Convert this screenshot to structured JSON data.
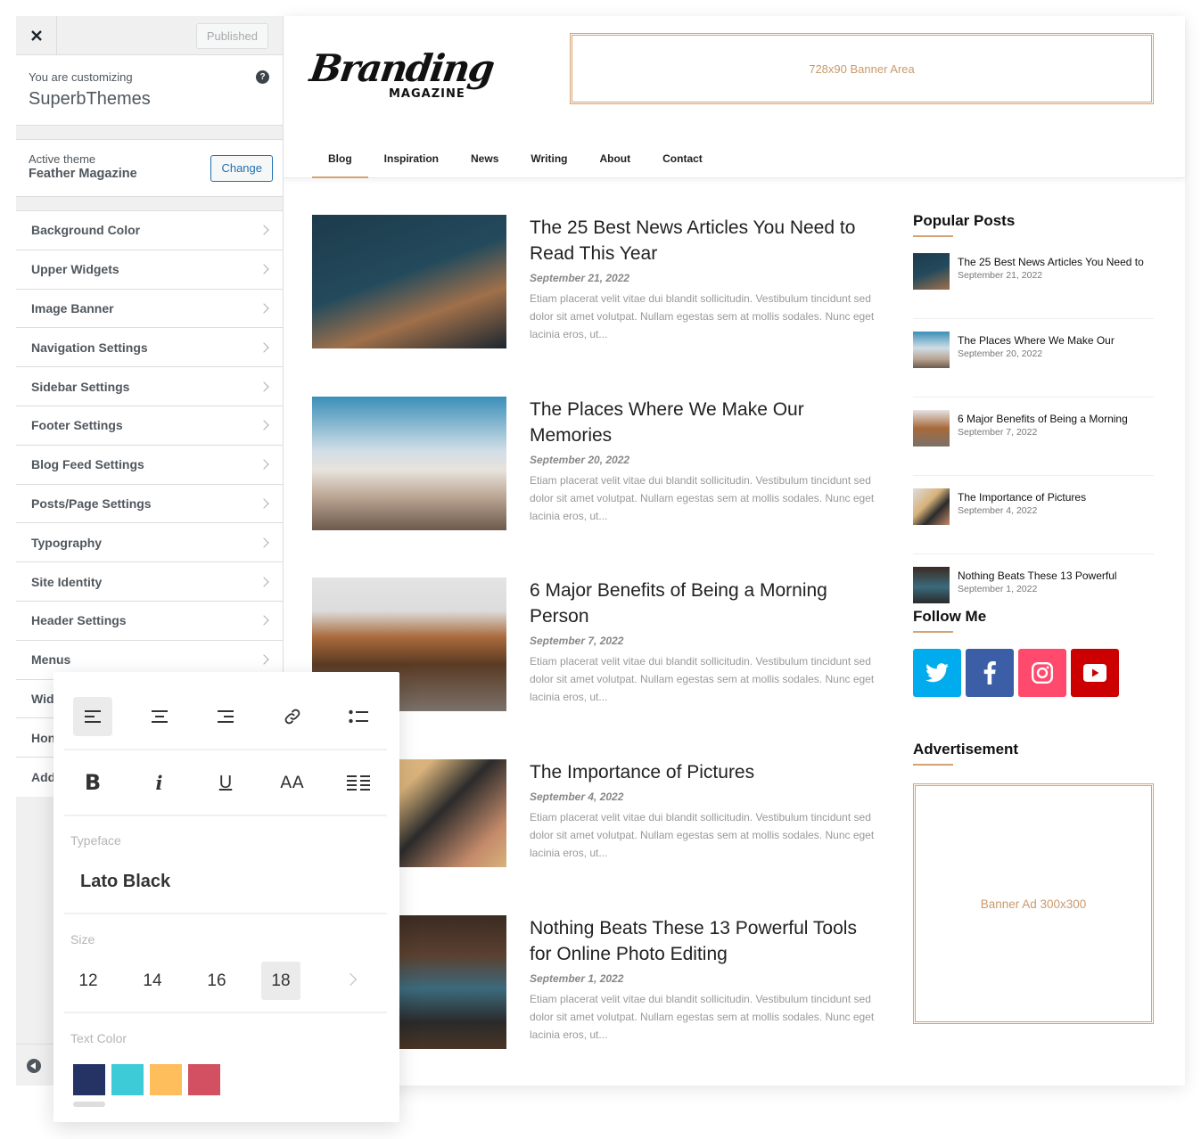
{
  "customizer": {
    "close_icon": "close-icon",
    "published_label": "Published",
    "customizing_label": "You are customizing",
    "site_name": "SuperbThemes",
    "help_icon": "?",
    "active_theme_label": "Active theme",
    "active_theme_name": "Feather Magazine",
    "change_label": "Change",
    "sections": [
      {
        "label": "Background Color"
      },
      {
        "label": "Upper Widgets"
      },
      {
        "label": "Image Banner"
      },
      {
        "label": "Navigation Settings"
      },
      {
        "label": "Sidebar Settings"
      },
      {
        "label": "Footer Settings"
      },
      {
        "label": "Blog Feed Settings"
      },
      {
        "label": "Posts/Page Settings"
      },
      {
        "label": "Typography"
      },
      {
        "label": "Site Identity"
      },
      {
        "label": "Header Settings"
      },
      {
        "label": "Menus"
      },
      {
        "label": "Wid"
      },
      {
        "label": "Hon"
      },
      {
        "label": "Add"
      }
    ]
  },
  "format_panel": {
    "align_buttons": [
      "align-left-icon",
      "align-center-icon",
      "align-right-icon",
      "link-icon",
      "list-icon"
    ],
    "style_buttons": {
      "bold": "B",
      "italic": "i",
      "underline": "U",
      "caps": "AA",
      "justify": "justify-icon"
    },
    "typeface_label": "Typeface",
    "typeface_value": "Lato Black",
    "size_label": "Size",
    "sizes": [
      "12",
      "14",
      "16",
      "18"
    ],
    "selected_size": "18",
    "text_color_label": "Text Color",
    "colors": [
      "#243364",
      "#3ecbd8",
      "#ffbe5c",
      "#d25062"
    ],
    "selected_color": "#243364"
  },
  "site": {
    "logo_script": "Branding",
    "logo_sub": "MAGAZINE",
    "top_banner": "728x90 Banner Area",
    "nav": [
      {
        "label": "Blog",
        "active": true
      },
      {
        "label": "Inspiration"
      },
      {
        "label": "News"
      },
      {
        "label": "Writing"
      },
      {
        "label": "About"
      },
      {
        "label": "Contact"
      }
    ],
    "posts": [
      {
        "title": "The 25 Best News Articles You Need to Read This Year",
        "date": "September 21, 2022",
        "excerpt": "Etiam placerat velit vitae dui blandit sollicitudin. Vestibulum tincidunt sed dolor sit amet volutpat. Nullam egestas sem at mollis sodales. Nunc eget lacinia eros, ut..."
      },
      {
        "title": "The Places Where We Make Our Memories",
        "date": "September 20, 2022",
        "excerpt": "Etiam placerat velit vitae dui blandit sollicitudin. Vestibulum tincidunt sed dolor sit amet volutpat. Nullam egestas sem at mollis sodales. Nunc eget lacinia eros, ut..."
      },
      {
        "title": "6 Major Benefits of Being a Morning Person",
        "date": "September 7, 2022",
        "excerpt": "Etiam placerat velit vitae dui blandit sollicitudin. Vestibulum tincidunt sed dolor sit amet volutpat. Nullam egestas sem at mollis sodales. Nunc eget lacinia eros, ut..."
      },
      {
        "title": "The Importance of Pictures",
        "date": "September 4, 2022",
        "excerpt": "Etiam placerat velit vitae dui blandit sollicitudin. Vestibulum tincidunt sed dolor sit amet volutpat. Nullam egestas sem at mollis sodales. Nunc eget lacinia eros, ut..."
      },
      {
        "title": "Nothing Beats These 13 Powerful Tools for Online Photo Editing",
        "date": "September 1, 2022",
        "excerpt": "Etiam placerat velit vitae dui blandit sollicitudin. Vestibulum tincidunt sed dolor sit amet volutpat. Nullam egestas sem at mollis sodales. Nunc eget lacinia eros, ut..."
      }
    ],
    "popular_posts_title": "Popular Posts",
    "popular_posts": [
      {
        "title": "The 25 Best News Articles You Need to",
        "date": "September 21, 2022"
      },
      {
        "title": "The Places Where We Make Our",
        "date": "September 20, 2022"
      },
      {
        "title": "6 Major Benefits of Being a Morning",
        "date": "September 7, 2022"
      },
      {
        "title": "The Importance of Pictures",
        "date": "September 4, 2022"
      },
      {
        "title": "Nothing Beats These 13 Powerful",
        "date": "September 1, 2022"
      }
    ],
    "follow_title": "Follow Me",
    "social": [
      {
        "name": "twitter-icon",
        "color": "#00aced"
      },
      {
        "name": "facebook-icon",
        "color": "#3b5998"
      },
      {
        "name": "instagram-icon",
        "color": "#ff4a6e"
      },
      {
        "name": "youtube-icon",
        "color": "#cc0000"
      }
    ],
    "advert_title": "Advertisement",
    "ad_box": "Banner Ad 300x300",
    "accent_color": "#d4a373"
  }
}
